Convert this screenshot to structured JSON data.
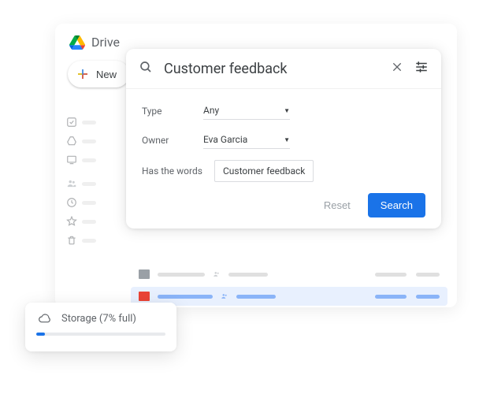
{
  "header": {
    "app_name": "Drive"
  },
  "sidebar": {
    "new_button_label": "New"
  },
  "search": {
    "query": "Customer feedback",
    "filters": {
      "type_label": "Type",
      "type_value": "Any",
      "owner_label": "Owner",
      "owner_value": "Eva Garcia",
      "words_label": "Has the words",
      "words_value": "Customer feedback"
    },
    "reset_label": "Reset",
    "search_label": "Search"
  },
  "storage": {
    "label": "Storage (7% full)",
    "percent": 7
  }
}
